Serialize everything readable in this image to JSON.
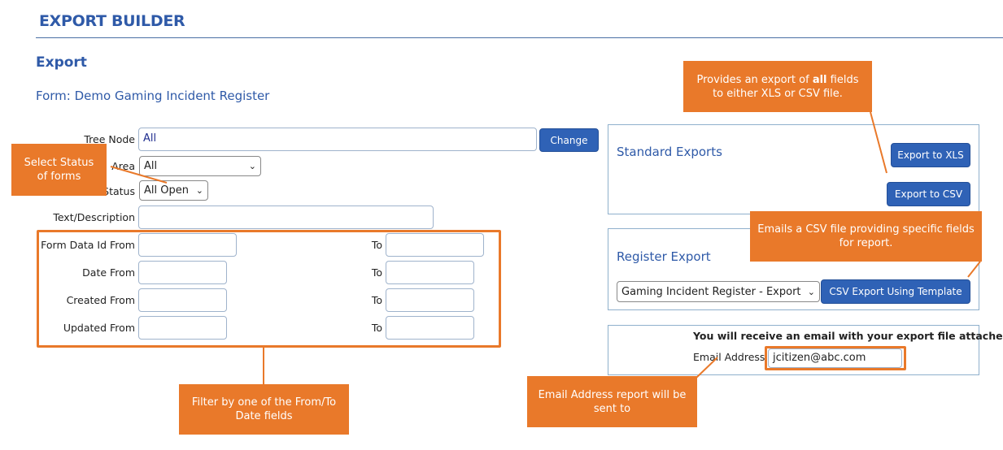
{
  "header": {
    "title": "EXPORT BUILDER"
  },
  "section": {
    "title": "Export",
    "form_name": "Form: Demo Gaming Incident Register"
  },
  "filters": {
    "tree_node": {
      "label": "Tree Node",
      "value": "All",
      "change_label": "Change"
    },
    "area": {
      "label": "Area",
      "selected": "All"
    },
    "status": {
      "label": "Status",
      "selected": "All Open"
    },
    "text_description": {
      "label": "Text/Description",
      "value": ""
    },
    "to_label": "To",
    "ranges": [
      {
        "label": "Form Data Id From",
        "from": "",
        "to": ""
      },
      {
        "label": "Date From",
        "from": "",
        "to": ""
      },
      {
        "label": "Created From",
        "from": "",
        "to": ""
      },
      {
        "label": "Updated From",
        "from": "",
        "to": ""
      }
    ]
  },
  "standard_exports": {
    "title": "Standard Exports",
    "xls_label": "Export to XLS",
    "csv_label": "Export to CSV"
  },
  "register_export": {
    "title": "Register Export",
    "template_selected": "Gaming Incident Register - Export",
    "button_label": "CSV Export Using Template"
  },
  "email": {
    "notice": "You will receive an email with your export file attached.",
    "label": "Email Address",
    "value": "jcitizen@abc.com"
  },
  "annotations": {
    "status": "Select Status of forms",
    "all_fields": "Provides an export of all fields to either XLS or CSV file.",
    "all_fields_pre": "Provides an export of ",
    "all_fields_bold": "all",
    "all_fields_post": " fields to either XLS or CSV file.",
    "csv_template": "Emails a CSV file providing specific fields for report.",
    "date_filter": "Filter by one of the From/To Date fields",
    "email_note": "Email Address report will be sent to"
  },
  "colors": {
    "accent": "#2f5aa8",
    "button": "#2f62b6",
    "annotation": "#e9792a"
  }
}
